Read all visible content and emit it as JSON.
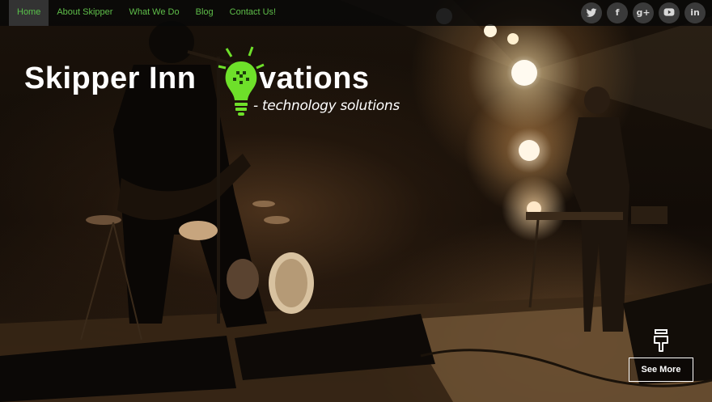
{
  "nav": {
    "items": [
      {
        "label": "Home",
        "active": true
      },
      {
        "label": "About Skipper",
        "active": false
      },
      {
        "label": "What We Do",
        "active": false
      },
      {
        "label": "Blog",
        "active": false
      },
      {
        "label": "Contact Us!",
        "active": false
      }
    ],
    "link_color": "#5fbf4a",
    "active_bg": "#333333"
  },
  "social": [
    {
      "icon": "twitter-icon",
      "glyph": "t"
    },
    {
      "icon": "facebook-icon",
      "glyph": "f"
    },
    {
      "icon": "google-plus-icon",
      "glyph": "g+"
    },
    {
      "icon": "youtube-icon",
      "glyph": "▶"
    },
    {
      "icon": "linkedin-icon",
      "glyph": "in"
    }
  ],
  "logo": {
    "word_part1": "Skipper Inn",
    "word_part2": "vations",
    "tagline": "- technology solutions",
    "bulb_color": "#6ee02a"
  },
  "cta": {
    "see_more_label": "See More",
    "scroll_icon": "pointing-hand-icon"
  }
}
